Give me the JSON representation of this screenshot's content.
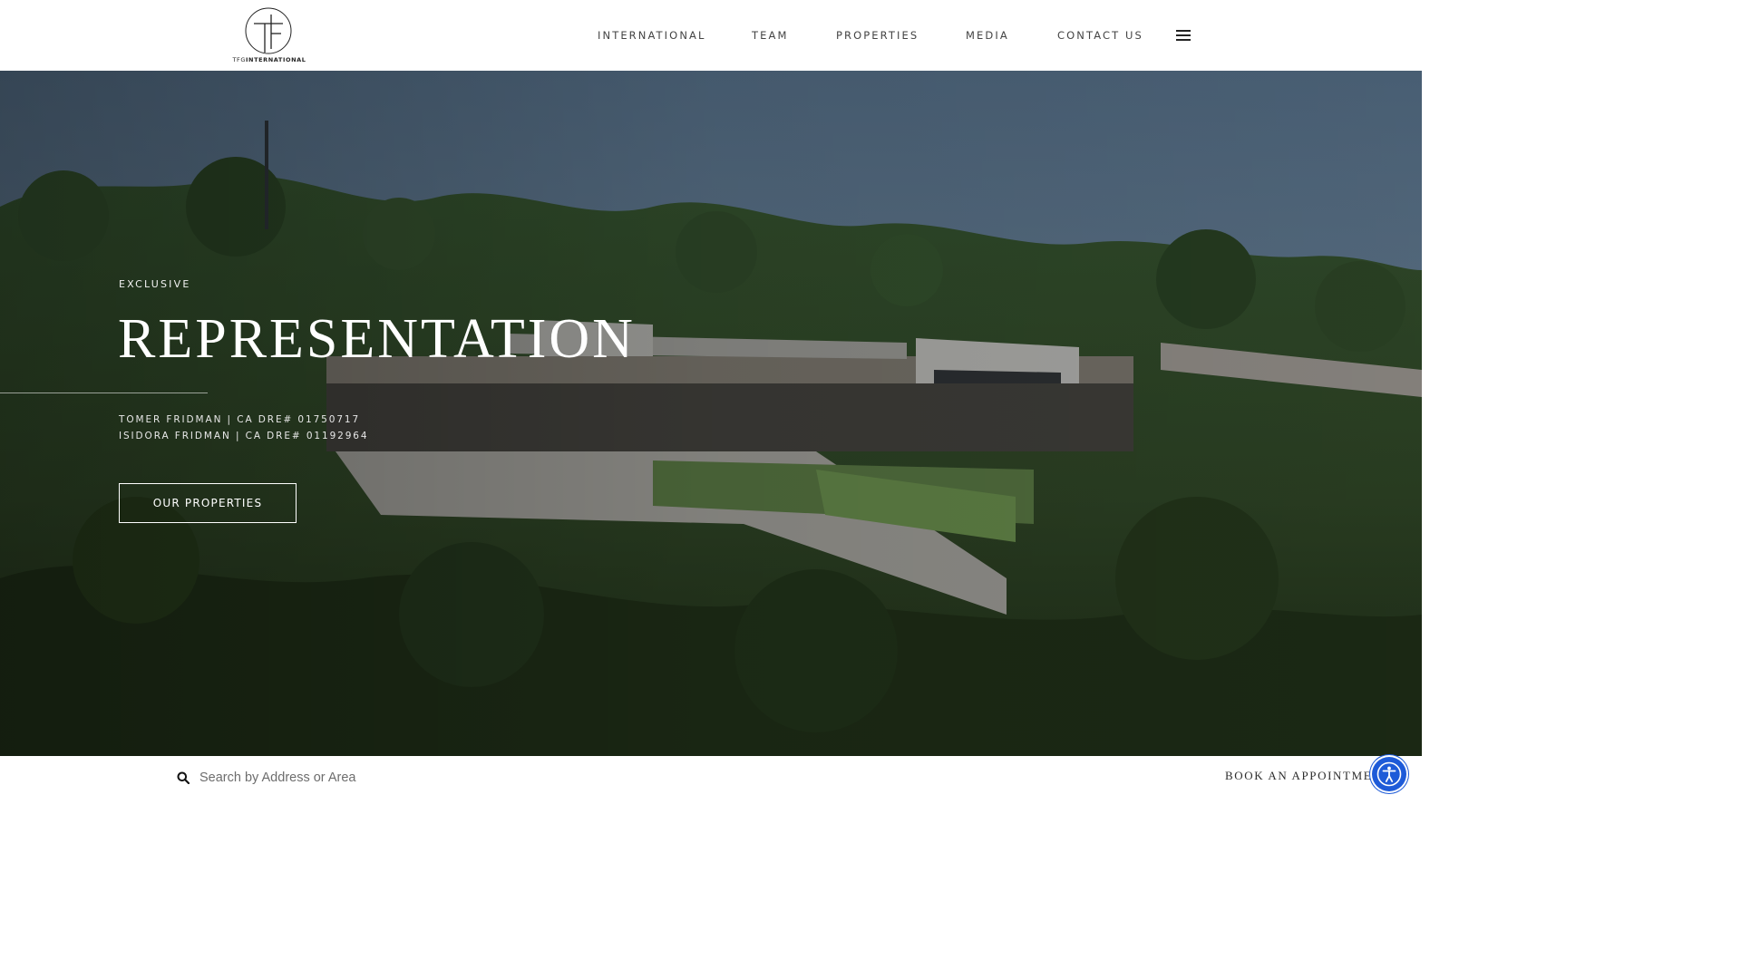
{
  "header": {
    "logo_prefix": "TFG",
    "logo_word": "INTERNATIONAL",
    "nav": [
      {
        "label": "INTERNATIONAL"
      },
      {
        "label": "TEAM"
      },
      {
        "label": "PROPERTIES"
      },
      {
        "label": "MEDIA"
      },
      {
        "label": "CONTACT US"
      }
    ]
  },
  "hero": {
    "eyebrow": "EXCLUSIVE",
    "title": "REPRESENTATION",
    "licenses": [
      "TOMER FRIDMAN | CA DRE# 01750717",
      "ISIDORA FRIDMAN | CA DRE# 01192964"
    ],
    "cta_label": "OUR PROPERTIES"
  },
  "bottom": {
    "search_placeholder": "Search by Address or Area",
    "book_label": "BOOK AN APPOINTMENT"
  },
  "colors": {
    "accessibility": "#1e5bd8"
  }
}
